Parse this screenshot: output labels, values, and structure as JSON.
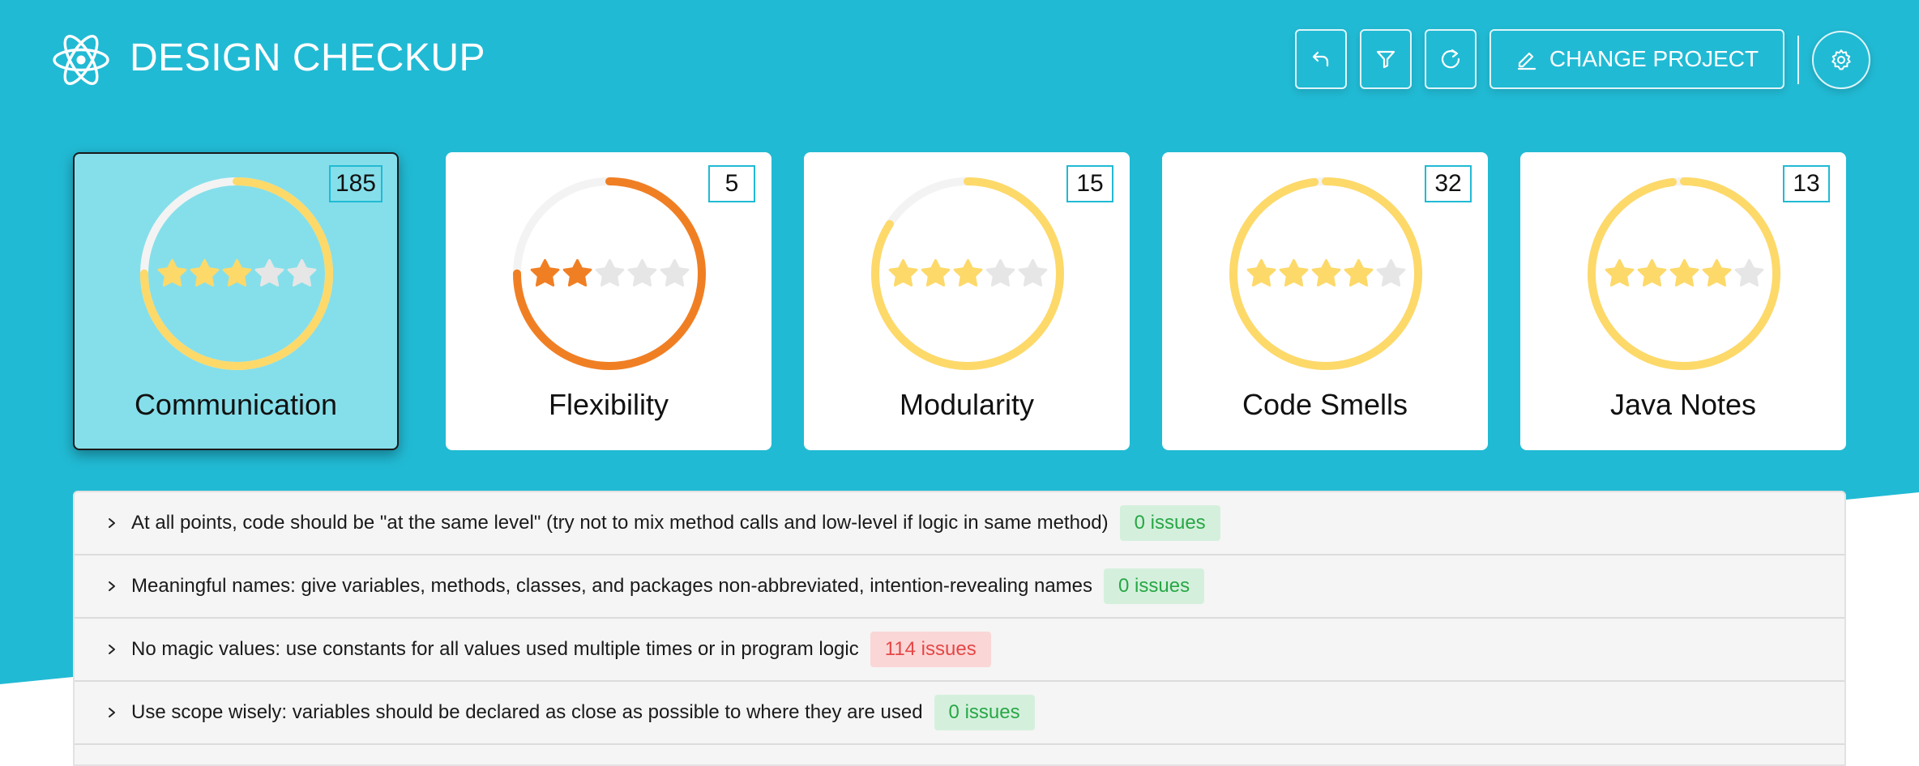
{
  "app": {
    "title": "DESIGN CHECKUP",
    "logo_icon": "react-atom-icon"
  },
  "toolbar": {
    "undo_icon": "undo-icon",
    "filter_icon": "filter-icon",
    "refresh_icon": "refresh-icon",
    "change_project_label": "CHANGE PROJECT",
    "change_project_icon": "pencil-icon",
    "settings_icon": "gear-icon"
  },
  "colors": {
    "header_bg": "#21bad4",
    "yellow": "#fdd96a",
    "orange": "#f07f24",
    "track": "#f3f3f3",
    "star_empty": "#e6e6e6",
    "selected_card": "#85dfea",
    "ok_text": "#28a745",
    "bad_text": "#e64646"
  },
  "categories": [
    {
      "name": "Communication",
      "count": "185",
      "stars": 3,
      "progress": 0.75,
      "color": "yellow",
      "selected": true
    },
    {
      "name": "Flexibility",
      "count": "5",
      "stars": 2,
      "progress": 0.75,
      "color": "orange",
      "selected": false
    },
    {
      "name": "Modularity",
      "count": "15",
      "stars": 3,
      "progress": 0.84,
      "color": "yellow",
      "selected": false
    },
    {
      "name": "Code Smells",
      "count": "32",
      "stars": 4,
      "progress": 0.98,
      "color": "yellow",
      "selected": false
    },
    {
      "name": "Java Notes",
      "count": "13",
      "stars": 4,
      "progress": 0.98,
      "color": "yellow",
      "selected": false
    }
  ],
  "rules": [
    {
      "text": "At all points, code should be \"at the same level\" (try not to mix method calls and low-level if logic in same method)",
      "issues": "0 issues",
      "status": "ok"
    },
    {
      "text": "Meaningful names: give variables, methods, classes, and packages non-abbreviated, intention-revealing names",
      "issues": "0 issues",
      "status": "ok"
    },
    {
      "text": "No magic values: use constants for all values used multiple times or in program logic",
      "issues": "114 issues",
      "status": "bad"
    },
    {
      "text": "Use scope wisely: variables should be declared as close as possible to where they are used",
      "issues": "0 issues",
      "status": "ok"
    }
  ]
}
